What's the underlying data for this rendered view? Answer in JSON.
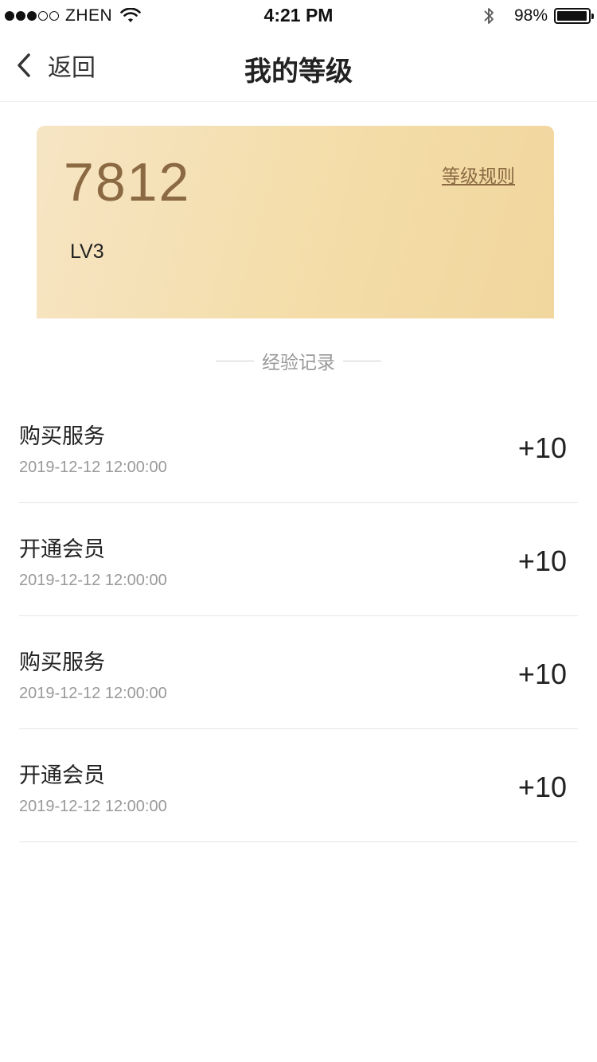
{
  "status_bar": {
    "carrier": "ZHEN",
    "time": "4:21 PM",
    "battery_percent": "98%",
    "battery_level": 0.98,
    "signal_bars_filled": 3,
    "signal_bars_total": 5
  },
  "nav": {
    "back_label": "返回",
    "title": "我的等级"
  },
  "level_card": {
    "score": "7812",
    "level": "LV3",
    "rules_link": "等级规则",
    "text_color": "#8b6a43"
  },
  "records_section": {
    "title": "经验记录"
  },
  "records": [
    {
      "title": "购买服务",
      "time": "2019-12-12 12:00:00",
      "points": "+10"
    },
    {
      "title": "开通会员",
      "time": "2019-12-12 12:00:00",
      "points": "+10"
    },
    {
      "title": "购买服务",
      "time": "2019-12-12 12:00:00",
      "points": "+10"
    },
    {
      "title": "开通会员",
      "time": "2019-12-12 12:00:00",
      "points": "+10"
    }
  ],
  "icons": [
    "wifi-icon",
    "bluetooth-icon",
    "battery-icon",
    "back-chevron-icon"
  ]
}
